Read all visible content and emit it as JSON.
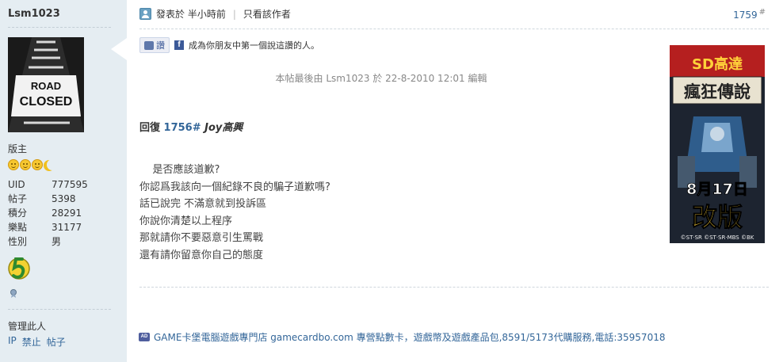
{
  "author": {
    "name": "Lsm1023",
    "group": "版主",
    "stats": [
      {
        "key": "UID",
        "value": "777595"
      },
      {
        "key": "帖子",
        "value": "5398"
      },
      {
        "key": "積分",
        "value": "28291"
      },
      {
        "key": "樂點",
        "value": "31177"
      },
      {
        "key": "性別",
        "value": "男"
      }
    ],
    "avatar_text": [
      "ROAD",
      "CLOSED"
    ],
    "manage_label": "管理此人",
    "manage_links": [
      "IP",
      "禁止",
      "帖子"
    ]
  },
  "post": {
    "posted_at": "發表於 半小時前",
    "only_author": "只看該作者",
    "floor": "1759",
    "floor_mark": "#",
    "like_label": "讚",
    "like_text": "成為你朋友中第一個說這讚的人。",
    "edit_note": "本帖最後由 Lsm1023 於 22-8-2010 12:01 編輯",
    "reply_prefix": "回復",
    "reply_floor": "1756#",
    "reply_to": "Joy高興",
    "body_lines": [
      "    是否應該道歉?",
      "你認爲我該向一個紀錄不良的騙子道歉嗎?",
      "話已說完 不滿意就到投訴區",
      "你說你清楚以上程序",
      "那就請你不要惡意引生罵戰",
      "還有請你留意你自己的態度"
    ]
  },
  "ad_image": {
    "brand": "SD高達",
    "title": "瘋狂傳說",
    "date": "8月17日",
    "headline": "改版",
    "credit": "©ST·SR ©ST·SR·MBS ©BK"
  },
  "footer_ad": {
    "badge": "AD",
    "text": "GAME卡堡電腦遊戲專門店 gamecardbo.com 專營點數卡，遊戲幣及遊戲產品包,8591/5173代購服務,電話:35957018"
  },
  "colors": {
    "sidebar_bg": "#e5edf2",
    "link": "#336699",
    "text": "#333333"
  }
}
